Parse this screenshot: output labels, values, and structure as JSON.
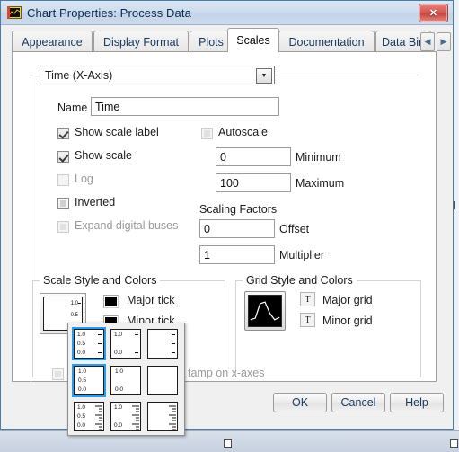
{
  "window": {
    "title": "Chart Properties: Process Data",
    "icon": "labview-chart-icon",
    "close_label": "✕"
  },
  "tabs": {
    "items": [
      {
        "label": "Appearance",
        "active": false
      },
      {
        "label": "Display Format",
        "active": false
      },
      {
        "label": "Plots",
        "active": false
      },
      {
        "label": "Scales",
        "active": true
      },
      {
        "label": "Documentation",
        "active": false
      },
      {
        "label": "Data Bin",
        "active": false
      }
    ],
    "scroll_left": "◀",
    "scroll_right": "▶"
  },
  "scales": {
    "axis_selector": {
      "value": "Time (X-Axis)",
      "arrow": "▼"
    },
    "name_label": "Name",
    "name_value": "Time",
    "checkboxes": [
      {
        "label": "Show scale label",
        "checked": true,
        "enabled": true
      },
      {
        "label": "Show scale",
        "checked": true,
        "enabled": true
      },
      {
        "label": "Log",
        "checked": false,
        "enabled": false
      },
      {
        "label": "Inverted",
        "checked": false,
        "enabled": true
      },
      {
        "label": "Expand digital buses",
        "checked": false,
        "enabled": false
      }
    ],
    "autoscale": {
      "label": "Autoscale",
      "checked": false
    },
    "minimum": {
      "label": "Minimum",
      "value": "0"
    },
    "maximum": {
      "label": "Maximum",
      "value": "100"
    },
    "scaling_factors_label": "Scaling Factors",
    "offset": {
      "label": "Offset",
      "value": "0"
    },
    "multiplier": {
      "label": "Multiplier",
      "value": "1"
    },
    "scale_style_group": "Scale Style and Colors",
    "scale_style_ticks": [
      {
        "label": "Major tick",
        "color": "#000000"
      },
      {
        "label": "Minor tick",
        "color": "#000000"
      }
    ],
    "scale_preview_ticks": [
      "1.0",
      "0.5",
      "0.0"
    ],
    "grid_style_group": "Grid Style and Colors",
    "grid_rows": [
      {
        "label": "Major grid",
        "glyph": "T"
      },
      {
        "label": "Minor grid",
        "glyph": "T"
      }
    ],
    "timestamp_option": {
      "label": "tamp on x-axes",
      "checked": false,
      "enabled": false
    }
  },
  "style_popup": {
    "cells": [
      {
        "row": 0,
        "col": 0,
        "labels": [
          "1.0",
          "0.5",
          "0.0"
        ],
        "marks": true,
        "ruler": false,
        "selected": true
      },
      {
        "row": 0,
        "col": 1,
        "labels": [
          "1.0",
          "",
          "0.0"
        ],
        "marks": true,
        "ruler": false,
        "selected": false
      },
      {
        "row": 0,
        "col": 2,
        "labels": [
          "",
          "",
          ""
        ],
        "marks": true,
        "ruler": false,
        "selected": false
      },
      {
        "row": 1,
        "col": 0,
        "labels": [
          "1.0",
          "0.5",
          "0.0"
        ],
        "marks": false,
        "ruler": false,
        "selected": true
      },
      {
        "row": 1,
        "col": 1,
        "labels": [
          "1.0",
          "",
          "0.0"
        ],
        "marks": false,
        "ruler": false,
        "selected": false
      },
      {
        "row": 1,
        "col": 2,
        "labels": [
          "",
          "",
          ""
        ],
        "marks": false,
        "ruler": false,
        "selected": false
      },
      {
        "row": 2,
        "col": 0,
        "labels": [
          "1.0",
          "0.5",
          "0.0"
        ],
        "marks": false,
        "ruler": true,
        "selected": false
      },
      {
        "row": 2,
        "col": 1,
        "labels": [
          "1.0",
          "",
          "0.0"
        ],
        "marks": false,
        "ruler": true,
        "selected": false
      },
      {
        "row": 2,
        "col": 2,
        "labels": [
          "",
          "",
          ""
        ],
        "marks": false,
        "ruler": true,
        "selected": false
      }
    ]
  },
  "footer": {
    "ok": "OK",
    "cancel": "Cancel",
    "help": "Help"
  },
  "colors": {
    "accent": "#2a9ced",
    "title_text": "#0c2a4d",
    "tick_color": "#000000",
    "close_button": "#c7453f"
  }
}
